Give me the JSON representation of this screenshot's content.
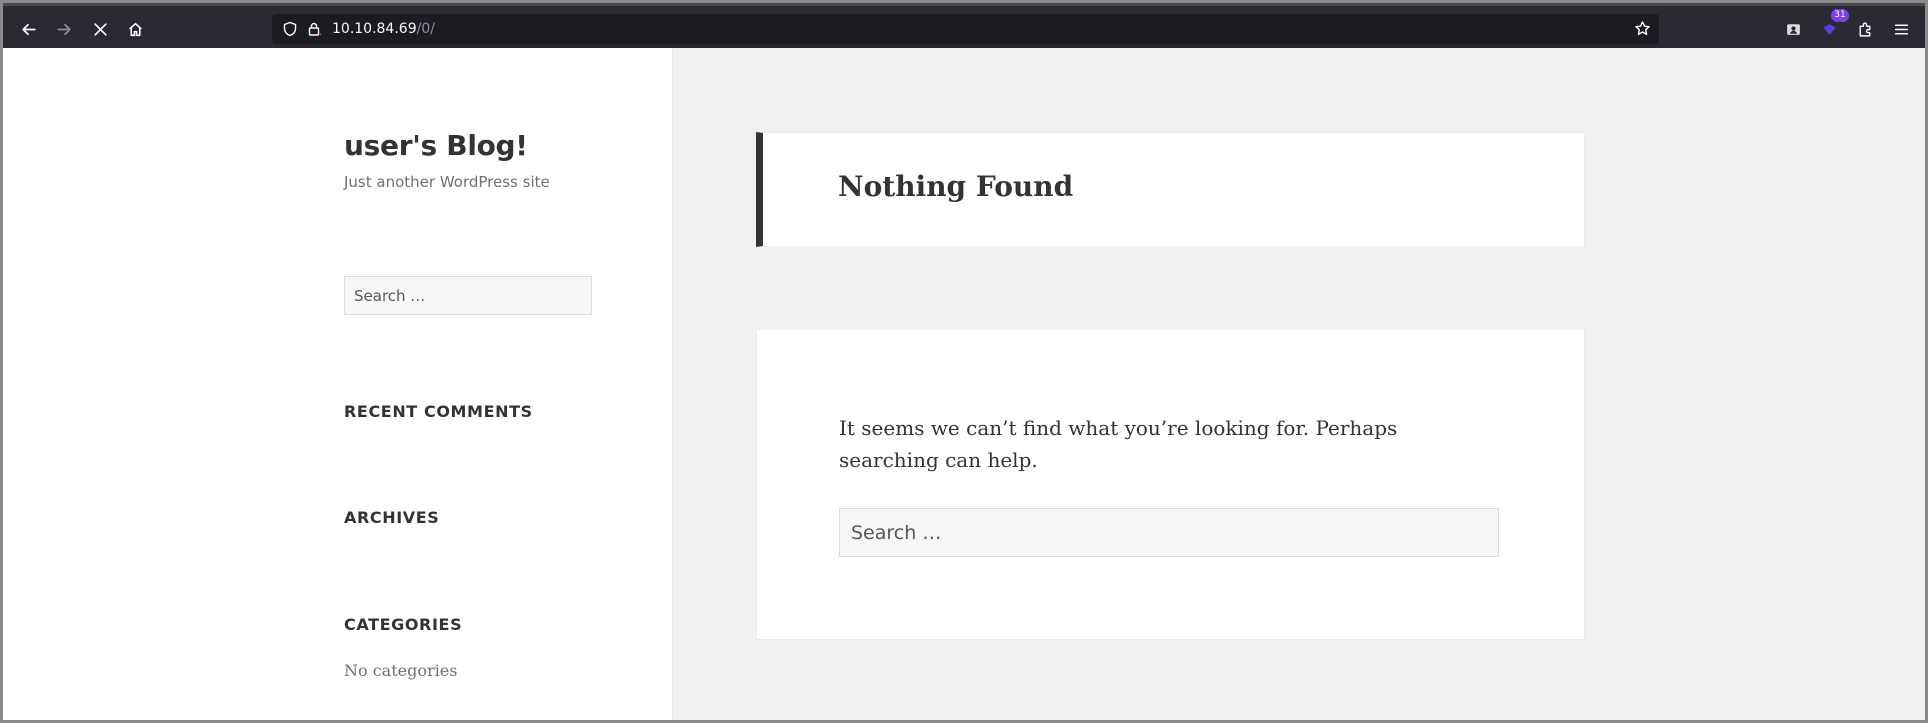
{
  "browser": {
    "url_host": "10.10.84.69",
    "url_path": "/0/",
    "extension_badge": "31",
    "icons": {
      "back": "back-arrow-icon",
      "forward": "forward-arrow-icon",
      "stop": "close-icon",
      "home": "home-icon",
      "shield": "shield-icon",
      "lock": "lock-icon",
      "bookmark": "star-icon",
      "extension_1": "container-icon",
      "extension_2": "extension-badge-icon",
      "extensions": "puzzle-icon",
      "menu": "hamburger-menu-icon"
    }
  },
  "site": {
    "title": "user's Blog!",
    "description": "Just another WordPress site"
  },
  "sidebar": {
    "search_placeholder": "Search …",
    "widgets": [
      {
        "title": "RECENT COMMENTS"
      },
      {
        "title": "ARCHIVES"
      },
      {
        "title": "CATEGORIES",
        "text": "No categories"
      }
    ]
  },
  "main": {
    "page_title": "Nothing Found",
    "message": "It seems we can’t find what you’re looking for. Perhaps searching can help.",
    "search_placeholder": "Search …"
  },
  "colors": {
    "toolbar": "#2b2a33",
    "urlbar": "#1c1b22",
    "page_background": "#f1f1f1",
    "card_background": "#ffffff",
    "text_dark": "#333333",
    "badge": "#7542e5"
  }
}
